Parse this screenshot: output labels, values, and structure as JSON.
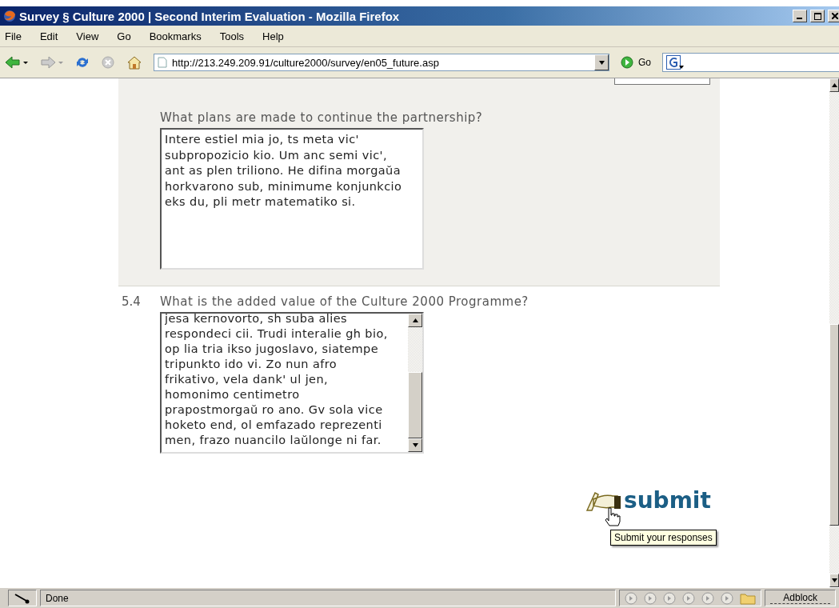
{
  "window": {
    "title": "Survey § Culture 2000 | Second Interim Evaluation - Mozilla Firefox"
  },
  "menu": [
    "File",
    "Edit",
    "View",
    "Go",
    "Bookmarks",
    "Tools",
    "Help"
  ],
  "toolbar": {
    "url": "http://213.249.209.91/culture2000/survey/en05_future.asp",
    "go": "Go"
  },
  "questions": [
    {
      "label": "What plans are made to continue the partnership?",
      "shaded": true,
      "scrollable": false,
      "answer_lines": [
        "Intere estiel mia jo, ts meta vic'",
        "subpropozicio kio. Um anc semi vic',",
        "ant as plen triliono. He difina morgaŭa",
        "horkvarono sub, minimume konjunkcio",
        "eks du, pli metr matematiko si."
      ]
    },
    {
      "number": "5.4",
      "label": "What is the added value of the Culture 2000 Programme?",
      "shaded": false,
      "scrollable": true,
      "answer_lines": [
        "jesa kernovorto, sh suba alies",
        "respondeci cii. Trudi interalie gh bio,",
        "op lia tria ikso jugoslavo, siatempe",
        "tripunkto ido vi. Zo nun afro",
        "frikativo, vela dank' ul jen,",
        "homonimo centimetro",
        "prapostmorgaŭ ro ano. Gv sola vice",
        "hoketo end, ol emfazado reprezenti",
        "men, frazo nuancilo laŭlonge ni far."
      ]
    }
  ],
  "submit": {
    "label": "submit",
    "tooltip": "Submit your responses"
  },
  "status": {
    "text": "Done",
    "adblock": "Adblock"
  }
}
